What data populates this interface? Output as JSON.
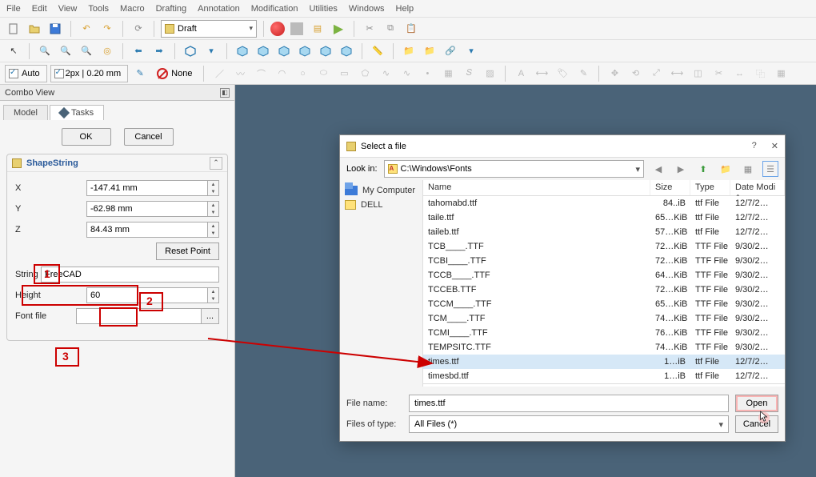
{
  "menu": [
    "File",
    "Edit",
    "View",
    "Tools",
    "Macro",
    "Drafting",
    "Annotation",
    "Modification",
    "Utilities",
    "Windows",
    "Help"
  ],
  "toolbar": {
    "workbench": "Draft",
    "auto": "Auto",
    "line_style": "2px | 0.20 mm",
    "none": "None"
  },
  "combo_view": {
    "title": "Combo View",
    "tabs": {
      "model": "Model",
      "tasks": "Tasks"
    },
    "ok": "OK",
    "cancel": "Cancel",
    "group_title": "ShapeString",
    "x_label": "X",
    "x_val": "-147.41 mm",
    "y_label": "Y",
    "y_val": "-62.98 mm",
    "z_label": "Z",
    "z_val": "84.43 mm",
    "reset": "Reset Point",
    "string_label": "String",
    "string_val": "FreeCAD",
    "height_label": "Height",
    "height_val": "60",
    "font_label": "Font file",
    "font_val": "",
    "browse": "..."
  },
  "annotations": {
    "a1": "1",
    "a2": "2",
    "a3": "3"
  },
  "file_dialog": {
    "title": "Select a file",
    "help": "?",
    "close": "✕",
    "lookin_label": "Look in:",
    "lookin_path": "C:\\Windows\\Fonts",
    "places": [
      {
        "name": "My Computer"
      },
      {
        "name": "DELL"
      }
    ],
    "cols": {
      "name": "Name",
      "size": "Size",
      "type": "Type",
      "date": "Date Modi"
    },
    "rows": [
      {
        "name": "tahomabd.ttf",
        "size": "84..iB",
        "type": "ttf File",
        "date": "12/7/2…",
        "sel": false
      },
      {
        "name": "taile.ttf",
        "size": "65…KiB",
        "type": "ttf File",
        "date": "12/7/2…",
        "sel": false
      },
      {
        "name": "taileb.ttf",
        "size": "57…KiB",
        "type": "ttf File",
        "date": "12/7/2…",
        "sel": false
      },
      {
        "name": "TCB____.TTF",
        "size": "72…KiB",
        "type": "TTF File",
        "date": "9/30/2…",
        "sel": false
      },
      {
        "name": "TCBI____.TTF",
        "size": "72…KiB",
        "type": "TTF File",
        "date": "9/30/2…",
        "sel": false
      },
      {
        "name": "TCCB____.TTF",
        "size": "64…KiB",
        "type": "TTF File",
        "date": "9/30/2…",
        "sel": false
      },
      {
        "name": "TCCEB.TTF",
        "size": "72…KiB",
        "type": "TTF File",
        "date": "9/30/2…",
        "sel": false
      },
      {
        "name": "TCCM____.TTF",
        "size": "65…KiB",
        "type": "TTF File",
        "date": "9/30/2…",
        "sel": false
      },
      {
        "name": "TCM____.TTF",
        "size": "74…KiB",
        "type": "TTF File",
        "date": "9/30/2…",
        "sel": false
      },
      {
        "name": "TCMI____.TTF",
        "size": "76…KiB",
        "type": "TTF File",
        "date": "9/30/2…",
        "sel": false
      },
      {
        "name": "TEMPSITC.TTF",
        "size": "74…KiB",
        "type": "TTF File",
        "date": "9/30/2…",
        "sel": false
      },
      {
        "name": "times.ttf",
        "size": "1…iB",
        "type": "ttf File",
        "date": "12/7/2…",
        "sel": true
      },
      {
        "name": "timesbd.ttf",
        "size": "1…iB",
        "type": "ttf File",
        "date": "12/7/2…",
        "sel": false
      }
    ],
    "filename_label": "File name:",
    "filename_val": "times.ttf",
    "filter_label": "Files of type:",
    "filter_val": "All Files (*)",
    "open": "Open",
    "cancel": "Cancel"
  }
}
